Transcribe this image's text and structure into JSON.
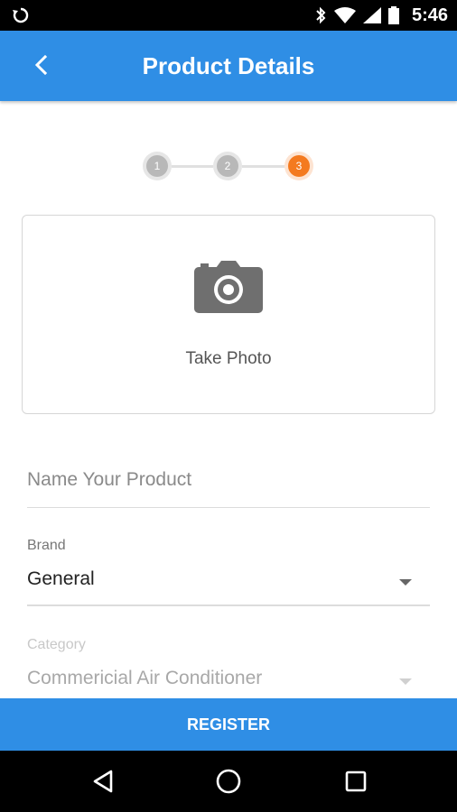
{
  "status_bar": {
    "time": "5:46",
    "icons": [
      "sync-icon",
      "bluetooth-icon",
      "wifi-icon",
      "cell-signal-icon",
      "battery-icon"
    ]
  },
  "app_bar": {
    "title": "Product Details",
    "back_icon": "chevron-left-icon",
    "color": "#2f8ee5"
  },
  "stepper": {
    "steps": [
      "1",
      "2",
      "3"
    ],
    "active_step": 3,
    "active_color": "#f47a1f"
  },
  "photo": {
    "label": "Take Photo",
    "icon": "camera-icon"
  },
  "form": {
    "name_placeholder": "Name Your Product",
    "brand_label": "Brand",
    "brand_value": "General",
    "category_label": "Category",
    "category_value": "Commericial Air Conditioner"
  },
  "register": {
    "label": "REGISTER"
  },
  "nav_bar": {
    "icons": [
      "back-triangle-icon",
      "home-circle-icon",
      "recents-square-icon"
    ]
  }
}
